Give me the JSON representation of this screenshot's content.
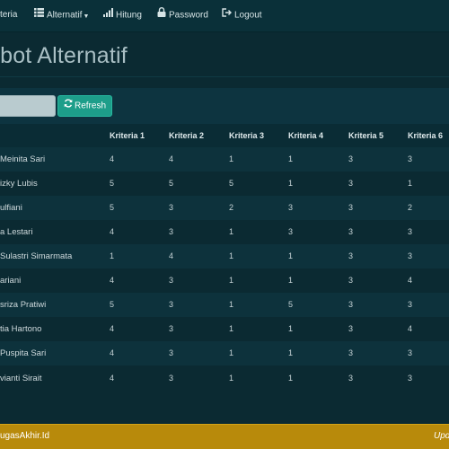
{
  "nav": {
    "kriteria_label": "teria",
    "alternatif_label": "Alternatif",
    "hitung_label": "Hitung",
    "password_label": "Password",
    "logout_label": "Logout"
  },
  "page": {
    "title": "obot Alternatif"
  },
  "toolbar": {
    "search_value": "",
    "refresh_label": "Refresh"
  },
  "table": {
    "headers": [
      "Kriteria 1",
      "Kriteria 2",
      "Kriteria 3",
      "Kriteria 4",
      "Kriteria 5",
      "Kriteria 6"
    ],
    "rows": [
      {
        "name": "Meinita Sari",
        "values": [
          "4",
          "4",
          "1",
          "1",
          "3",
          "3"
        ]
      },
      {
        "name": "izky Lubis",
        "values": [
          "5",
          "5",
          "5",
          "1",
          "3",
          "1"
        ]
      },
      {
        "name": "ulfiani",
        "values": [
          "5",
          "3",
          "2",
          "3",
          "3",
          "2"
        ]
      },
      {
        "name": "a Lestari",
        "values": [
          "4",
          "3",
          "1",
          "3",
          "3",
          "3"
        ]
      },
      {
        "name": "Sulastri Simarmata",
        "values": [
          "1",
          "4",
          "1",
          "1",
          "3",
          "3"
        ]
      },
      {
        "name": "ariani",
        "values": [
          "4",
          "3",
          "1",
          "1",
          "3",
          "4"
        ]
      },
      {
        "name": "sriza Pratiwi",
        "values": [
          "5",
          "3",
          "1",
          "5",
          "3",
          "3"
        ]
      },
      {
        "name": "tia Hartono",
        "values": [
          "4",
          "3",
          "1",
          "1",
          "3",
          "4"
        ]
      },
      {
        "name": "Puspita Sari",
        "values": [
          "4",
          "3",
          "1",
          "1",
          "3",
          "3"
        ]
      },
      {
        "name": "vianti Sirait",
        "values": [
          "4",
          "3",
          "1",
          "1",
          "3",
          "3"
        ]
      }
    ]
  },
  "footer": {
    "left_text": "ugasAkhir.Id",
    "right_text": "Upd"
  },
  "colors": {
    "background": "#0b2a32",
    "navbar": "#0a3039",
    "accent_button": "#1d9e8a",
    "footer": "#b88a0b"
  }
}
